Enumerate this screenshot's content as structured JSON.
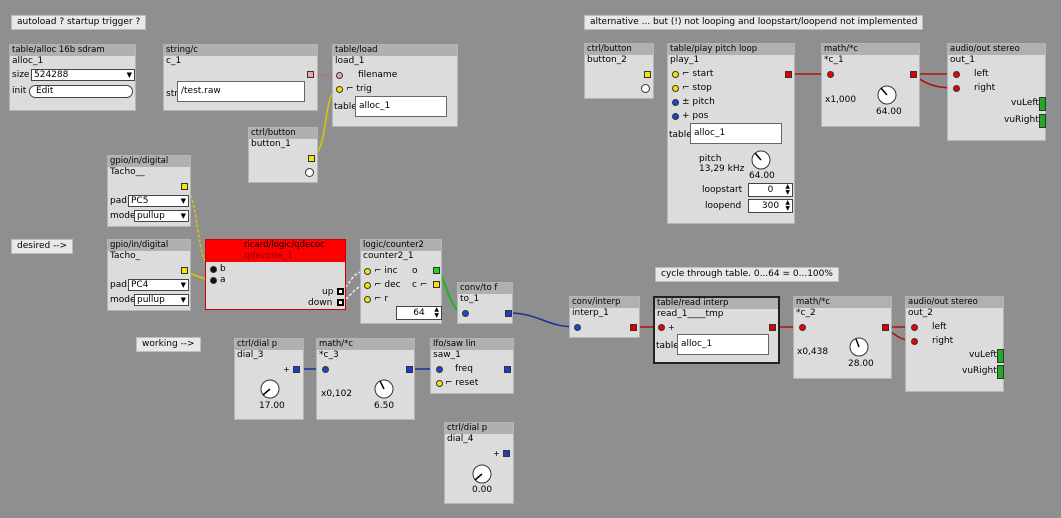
{
  "comments": {
    "autoload": "autoload ? startup trigger ?",
    "alternative": "alternative ... but (!) not looping and loopstart/loopend not implemented",
    "desired": "desired -->",
    "working": "working -->",
    "cycle": "cycle through table. 0...64 = 0...100%"
  },
  "alloc": {
    "title": "table/alloc 16b sdram",
    "instance": "alloc_1",
    "size_label": "size",
    "size_value": "524288",
    "init_label": "init",
    "init_button": "Edit"
  },
  "stringc": {
    "title": "string/c",
    "instance": "c_1",
    "str_label": "str",
    "str_value": "/test.raw"
  },
  "tableload": {
    "title": "table/load",
    "instance": "load_1",
    "filename": "filename",
    "trig": "trig",
    "table_label": "table",
    "table_value": "alloc_1"
  },
  "ctrlbutton1": {
    "title": "ctrl/button",
    "instance": "button_1"
  },
  "gpio1": {
    "title": "gpio/in/digital",
    "instance": "Tacho__",
    "pad_label": "pad",
    "pad_value": "PC5",
    "mode_label": "mode",
    "mode_value": "pullup"
  },
  "gpio2": {
    "title": "gpio/in/digital",
    "instance": "Tacho_",
    "pad_label": "pad",
    "pad_value": "PC4",
    "mode_label": "mode",
    "mode_value": "pullup"
  },
  "qdecode": {
    "title": "ricard/logic/qdecoc",
    "instance": "qdecode_1",
    "in_b": "b",
    "in_a": "a",
    "out_up": "up",
    "out_down": "down"
  },
  "counter": {
    "title": "logic/counter2",
    "instance": "counter2_1",
    "inc": "inc",
    "dec": "dec",
    "r": "r",
    "o": "o",
    "c": "c",
    "value": "64"
  },
  "convtof": {
    "title": "conv/to f",
    "instance": "to_1"
  },
  "dial3": {
    "title": "ctrl/dial p",
    "instance": "dial_3",
    "value": "17.00"
  },
  "mathc3": {
    "title": "math/*c",
    "instance": "*c_3",
    "mult": "x0,102",
    "value": "6.50"
  },
  "lfo": {
    "title": "lfo/saw lin",
    "instance": "saw_1",
    "freq": "freq",
    "reset": "reset"
  },
  "dial4": {
    "title": "ctrl/dial p",
    "instance": "dial_4",
    "value": "0.00"
  },
  "convinterp": {
    "title": "conv/interp",
    "instance": "interp_1"
  },
  "readinterp": {
    "title": "table/read interp",
    "instance": "read_1____tmp",
    "table_label": "table",
    "table_value": "alloc_1"
  },
  "mathc2": {
    "title": "math/*c",
    "instance": "*c_2",
    "mult": "x0,438",
    "value": "28.00"
  },
  "audioout2": {
    "title": "audio/out stereo",
    "instance": "out_2",
    "left": "left",
    "right": "right",
    "vuleft": "vuLeft",
    "vuright": "vuRight"
  },
  "ctrlbutton2": {
    "title": "ctrl/button",
    "instance": "button_2"
  },
  "playloop": {
    "title": "table/play pitch loop",
    "instance": "play_1",
    "start": "start",
    "stop": "stop",
    "pitch": "pitch",
    "pos": "pos",
    "table_label": "table",
    "table_value": "alloc_1",
    "pitch_label": "pitch",
    "pitch_freq": "13,29 kHz",
    "pitch_value": "64.00",
    "loopstart_label": "loopstart",
    "loopstart_value": "0",
    "loopend_label": "loopend",
    "loopend_value": "300"
  },
  "mathc1": {
    "title": "math/*c",
    "instance": "*c_1",
    "mult": "x1,000",
    "value": "64.00"
  },
  "audioout1": {
    "title": "audio/out stereo",
    "instance": "out_1",
    "left": "left",
    "right": "right",
    "vuleft": "vuLeft",
    "vuright": "vuRight"
  },
  "colors": {
    "background": "#8f8f8f",
    "object": "#dcdcdc",
    "title": "#b0b0b0",
    "wire_red": "#b01010",
    "wire_blue": "#1a2f9a",
    "wire_yellow": "#d8c800",
    "wire_green": "#18b818"
  }
}
